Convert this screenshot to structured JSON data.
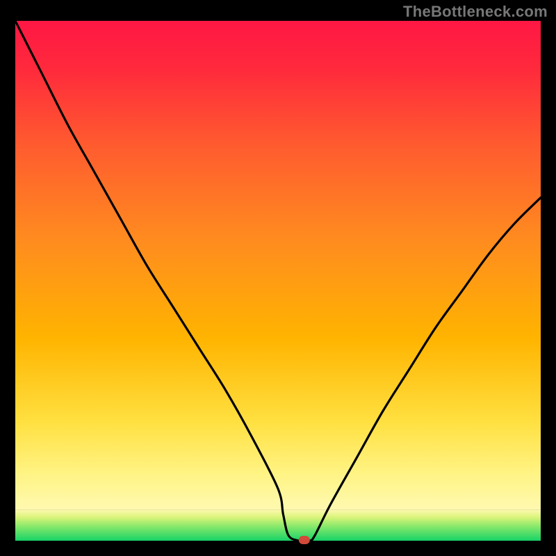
{
  "watermark": "TheBottleneck.com",
  "chart_data": {
    "type": "line",
    "title": "",
    "xlabel": "",
    "ylabel": "",
    "xlim": [
      0,
      100
    ],
    "ylim": [
      0,
      100
    ],
    "grid": false,
    "legend": false,
    "annotations": [],
    "series": [
      {
        "name": "curve",
        "x": [
          0,
          5,
          10,
          15,
          20,
          25,
          30,
          35,
          40,
          45,
          50,
          51,
          52,
          54,
          56,
          57,
          60,
          65,
          70,
          75,
          80,
          85,
          90,
          95,
          100
        ],
        "y": [
          100,
          90,
          80,
          71,
          62,
          53,
          45,
          37,
          29,
          20,
          10,
          5,
          1,
          0,
          0,
          1,
          7,
          16,
          25,
          33,
          41,
          48,
          55,
          61,
          66
        ]
      }
    ],
    "marker": {
      "x": 55,
      "y": 0
    },
    "background": "red-yellow-green vertical gradient",
    "green_band_top": 6
  }
}
